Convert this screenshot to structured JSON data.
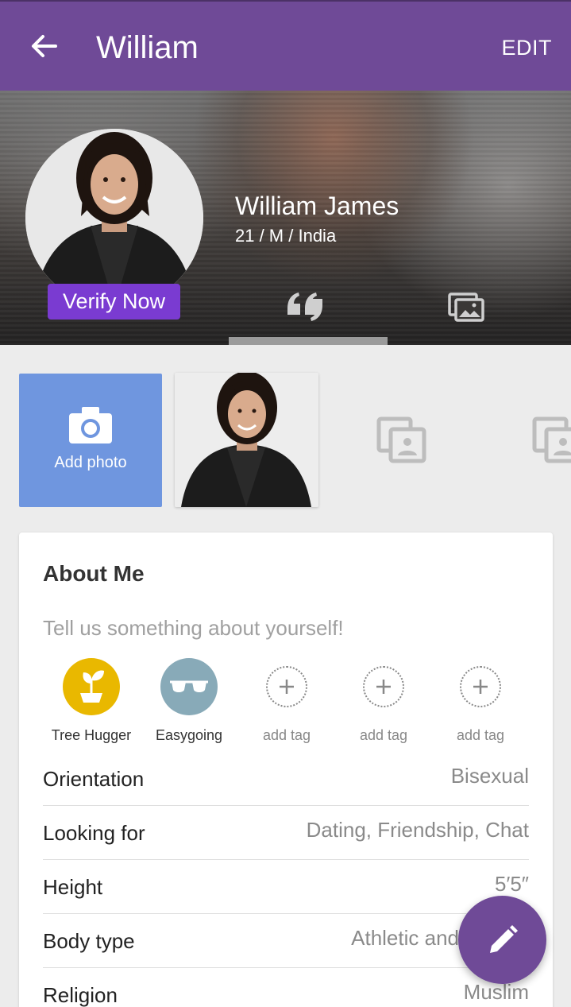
{
  "topbar": {
    "title": "William",
    "edit_label": "EDIT"
  },
  "banner": {
    "name": "William James",
    "meta": "21 / M / India",
    "verify_label": "Verify Now"
  },
  "photos": {
    "add_label": "Add photo"
  },
  "about": {
    "title": "About Me",
    "placeholder": "Tell us something about yourself!",
    "tags": [
      {
        "label": "Tree Hugger",
        "icon": "sprout-icon",
        "color": "#e9b800"
      },
      {
        "label": "Easygoing",
        "icon": "sunglasses-icon",
        "color": "#88aab8"
      },
      {
        "label": "add tag",
        "icon": "plus-icon"
      },
      {
        "label": "add tag",
        "icon": "plus-icon"
      },
      {
        "label": "add tag",
        "icon": "plus-icon"
      }
    ],
    "fields": [
      {
        "key": "Orientation",
        "value": "Bisexual"
      },
      {
        "key": "Looking for",
        "value": "Dating, Friendship, Chat"
      },
      {
        "key": "Height",
        "value": "5′5″"
      },
      {
        "key": "Body type",
        "value": "Athletic and"
      },
      {
        "key": "Religion",
        "value": "Muslim"
      }
    ]
  },
  "colors": {
    "primary": "#6f4a97",
    "verify": "#7a3bd1",
    "add_photo": "#6f96df"
  }
}
